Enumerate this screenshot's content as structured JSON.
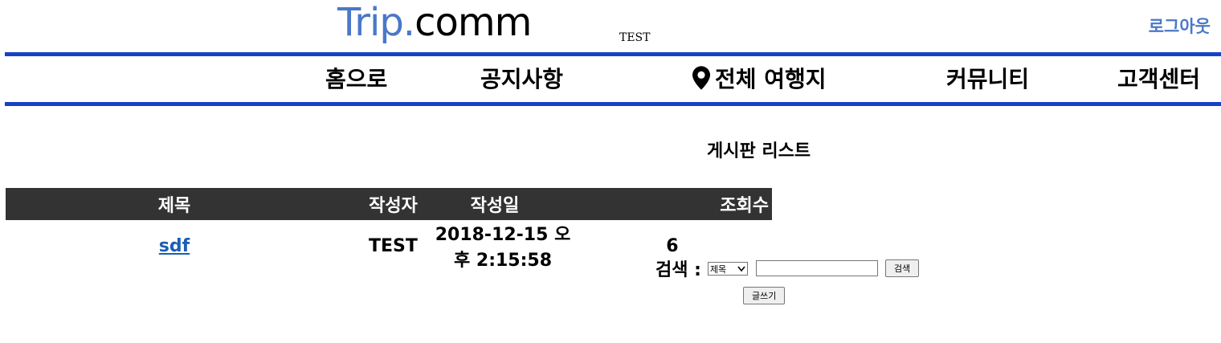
{
  "header": {
    "logo_part1": "Trip.",
    "logo_part2": "comm",
    "user_name": "TEST",
    "logout": "로그아웃"
  },
  "nav": {
    "home": "홈으로",
    "notice": "공지사항",
    "places": "전체 여행지",
    "community": "커뮤니티",
    "support": "고객센터"
  },
  "board": {
    "title": "게시판 리스트",
    "columns": {
      "title": "제목",
      "writer": "작성자",
      "date": "작성일",
      "views": "조회수"
    },
    "rows": [
      {
        "title": "sdf",
        "writer": "TEST",
        "date": "2018-12-15 오후 2:15:58",
        "views": "6"
      }
    ]
  },
  "search": {
    "label": "검색 :",
    "select_value": "제목",
    "input_value": "",
    "button": "검색"
  },
  "write_button": "글쓰기",
  "colors": {
    "accent": "#1642c8",
    "logo_blue": "#4a78c8",
    "header_bg": "#333333",
    "link": "#1a5fb4"
  },
  "icons": {
    "places": "map-pin-icon",
    "select": "chevron-down-icon"
  }
}
